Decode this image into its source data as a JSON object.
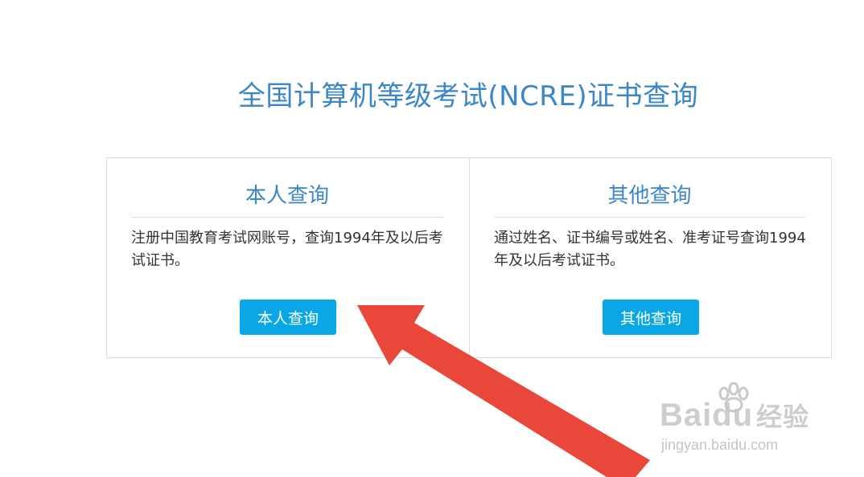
{
  "page": {
    "title": "全国计算机等级考试(NCRE)证书查询"
  },
  "panels": [
    {
      "title": "本人查询",
      "description": "注册中国教育考试网账号，查询1994年及以后考试证书。",
      "button_label": "本人查询"
    },
    {
      "title": "其他查询",
      "description": "通过姓名、证书编号或姓名、准考证号查询1994年及以后考试证书。",
      "button_label": "其他查询"
    }
  ],
  "watermark": {
    "brand": "Baidu",
    "brand_cn": "经验",
    "url": "jingyan.baidu.com"
  },
  "colors": {
    "accent": "#3a86c8",
    "button": "#0aa7e6",
    "arrow": "#e8473a"
  },
  "icons": {
    "annotation": "red-arrow-icon",
    "watermark": "paw-icon"
  }
}
